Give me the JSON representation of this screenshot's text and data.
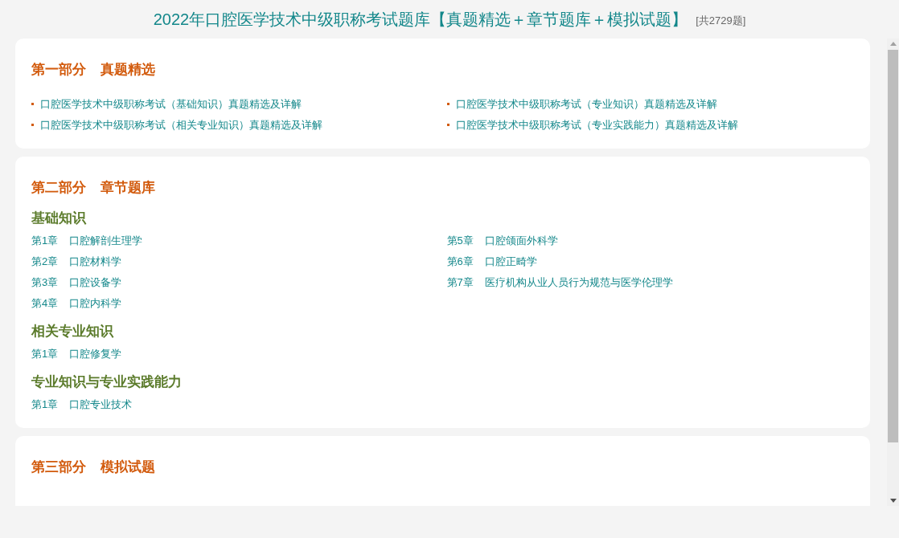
{
  "page_title": "2022年口腔医学技术中级职称考试题库【真题精选＋章节题库＋模拟试题】",
  "question_count": "[共2729题]",
  "sections": [
    {
      "part": "第一部分",
      "name": "真题精选",
      "kind": "links",
      "links": [
        {
          "text": "口腔医学技术中级职称考试（基础知识）真题精选及详解"
        },
        {
          "text": "口腔医学技术中级职称考试（专业知识）真题精选及详解"
        },
        {
          "text": "口腔医学技术中级职称考试（相关专业知识）真题精选及详解"
        },
        {
          "text": "口腔医学技术中级职称考试（专业实践能力）真题精选及详解"
        }
      ]
    },
    {
      "part": "第二部分",
      "name": "章节题库",
      "kind": "chapters",
      "groups": [
        {
          "title": "基础知识",
          "columns": [
            [
              {
                "num": "第1章",
                "title": "口腔解剖生理学"
              },
              {
                "num": "第2章",
                "title": "口腔材料学"
              },
              {
                "num": "第3章",
                "title": "口腔设备学"
              },
              {
                "num": "第4章",
                "title": "口腔内科学"
              }
            ],
            [
              {
                "num": "第5章",
                "title": "口腔颌面外科学"
              },
              {
                "num": "第6章",
                "title": "口腔正畸学"
              },
              {
                "num": "第7章",
                "title": "医疗机构从业人员行为规范与医学伦理学"
              }
            ]
          ]
        },
        {
          "title": "相关专业知识",
          "columns": [
            [
              {
                "num": "第1章",
                "title": "口腔修复学"
              }
            ]
          ]
        },
        {
          "title": "专业知识与专业实践能力",
          "columns": [
            [
              {
                "num": "第1章",
                "title": "口腔专业技术"
              }
            ]
          ]
        }
      ]
    },
    {
      "part": "第三部分",
      "name": "模拟试题",
      "kind": "links"
    }
  ]
}
